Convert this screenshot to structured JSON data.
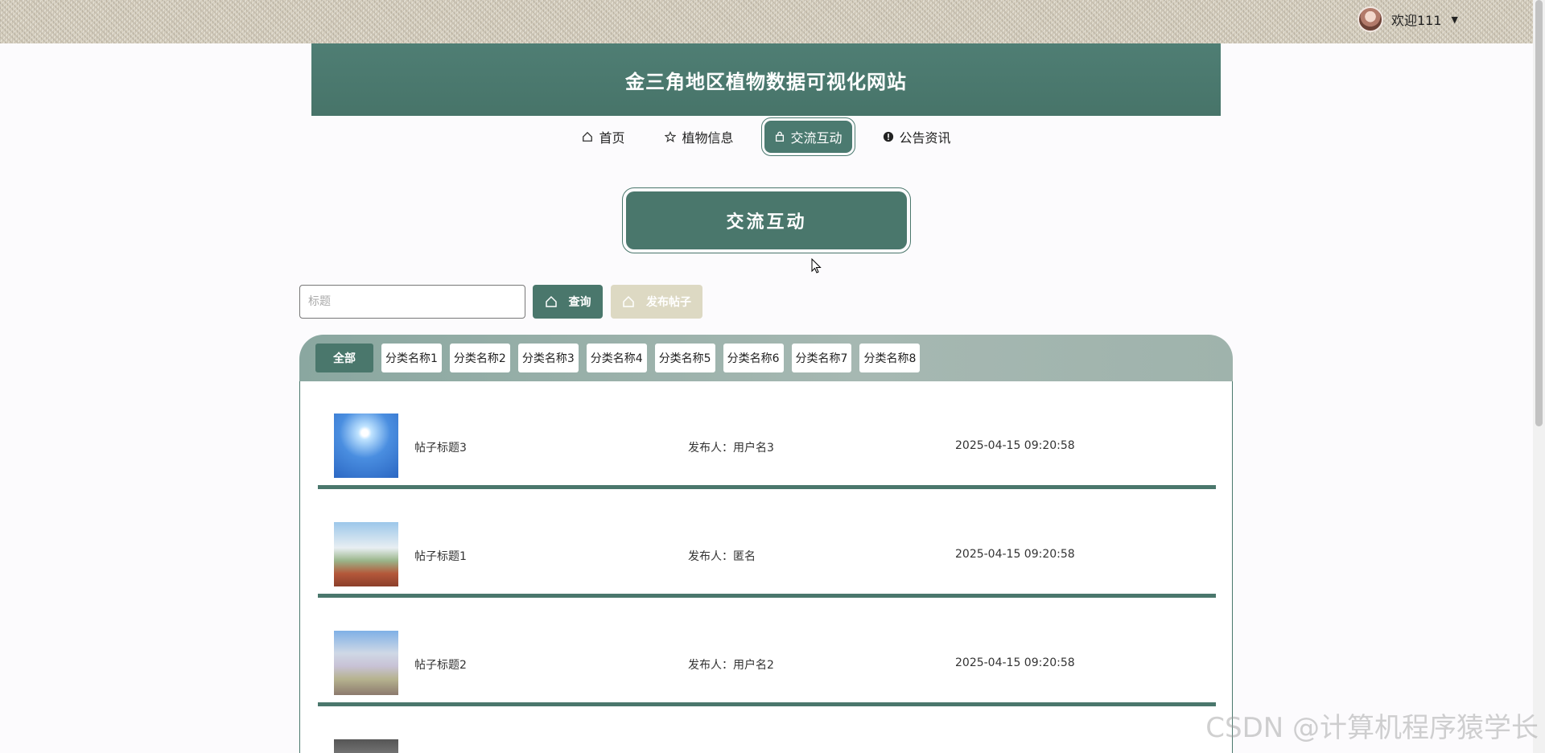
{
  "user": {
    "greeting": "欢迎111"
  },
  "header": {
    "title": "金三角地区植物数据可视化网站"
  },
  "nav": {
    "items": [
      {
        "label": "首页",
        "icon": "home-icon",
        "active": false
      },
      {
        "label": "植物信息",
        "icon": "star-icon",
        "active": false
      },
      {
        "label": "交流互动",
        "icon": "bag-icon",
        "active": true
      },
      {
        "label": "公告资讯",
        "icon": "info-icon",
        "active": false
      }
    ]
  },
  "section": {
    "title": "交流互动"
  },
  "search": {
    "placeholder": "标题",
    "query_label": "查询",
    "publish_label": "发布帖子"
  },
  "categories": [
    "全部",
    "分类名称1",
    "分类名称2",
    "分类名称3",
    "分类名称4",
    "分类名称5",
    "分类名称6",
    "分类名称7",
    "分类名称8"
  ],
  "posts": [
    {
      "title": "帖子标题3",
      "author_label": "发布人：用户名3",
      "time": "2025-04-15 09:20:58",
      "thumb": "sky"
    },
    {
      "title": "帖子标题1",
      "author_label": "发布人：匿名",
      "time": "2025-04-15 09:20:58",
      "thumb": "field"
    },
    {
      "title": "帖子标题2",
      "author_label": "发布人：用户名2",
      "time": "2025-04-15 09:20:58",
      "thumb": "city"
    }
  ],
  "watermark": "CSDN @计算机程序猿学长",
  "colors": {
    "primary": "#4a776c",
    "banner": "#4f7e74",
    "publish": "#ddd9c3"
  }
}
